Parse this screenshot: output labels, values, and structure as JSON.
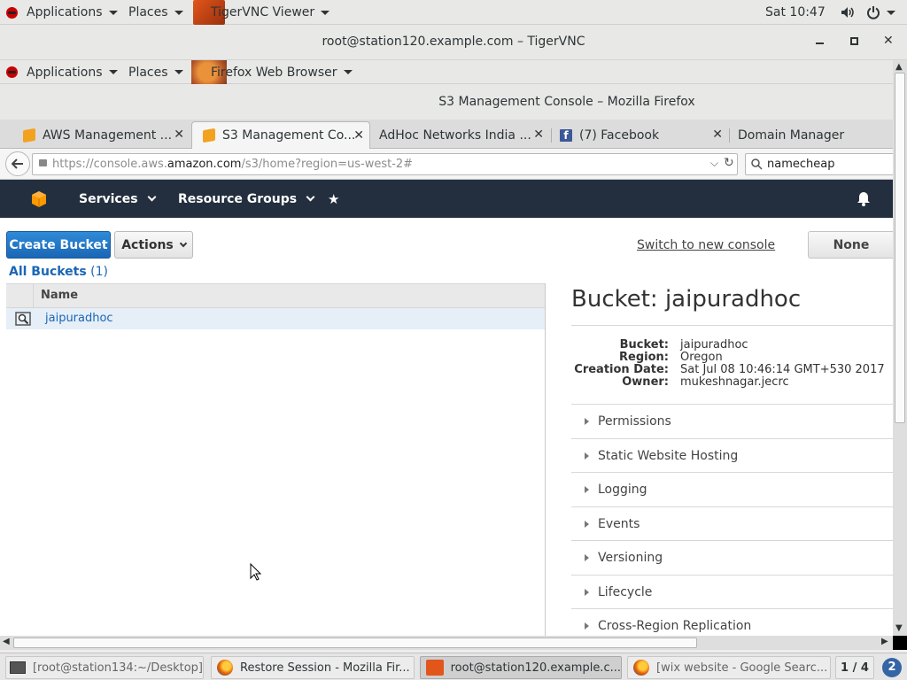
{
  "outer_bar": {
    "applications": "Applications",
    "places": "Places",
    "app_name": "TigerVNC Viewer",
    "clock": "Sat 10:47"
  },
  "vnc_window": {
    "title": "root@station120.example.com – TigerVNC"
  },
  "inner_bar": {
    "applications": "Applications",
    "places": "Places",
    "app_name": "Firefox Web Browser"
  },
  "firefox": {
    "title": "S3 Management Console – Mozilla Firefox",
    "tabs": [
      {
        "label": "AWS Management ..."
      },
      {
        "label": "S3 Management Co..."
      },
      {
        "label": "AdHoc Networks India ..."
      },
      {
        "label": "(7) Facebook"
      },
      {
        "label": "Domain Manager"
      }
    ],
    "url_prefix": "https://console.aws.",
    "url_domain": "amazon.com",
    "url_suffix": "/s3/home?region=us-west-2#",
    "search_value": "namecheap"
  },
  "aws": {
    "services": "Services",
    "resource_groups": "Resource Groups",
    "create_bucket": "Create Bucket",
    "actions": "Actions",
    "switch_console": "Switch to new console",
    "none_button": "None",
    "all_buckets": "All Buckets",
    "bucket_count": "(1)",
    "name_column": "Name",
    "buckets": [
      "jaipuradhoc"
    ],
    "detail_title": "Bucket: jaipuradhoc",
    "details": [
      {
        "label": "Bucket:",
        "value": "jaipuradhoc"
      },
      {
        "label": "Region:",
        "value": "Oregon"
      },
      {
        "label": "Creation Date:",
        "value": "Sat Jul 08 10:46:14 GMT+530 2017"
      },
      {
        "label": "Owner:",
        "value": "mukeshnagar.jecrc"
      }
    ],
    "sections": [
      "Permissions",
      "Static Website Hosting",
      "Logging",
      "Events",
      "Versioning",
      "Lifecycle",
      "Cross-Region Replication"
    ]
  },
  "taskbar": {
    "items": [
      {
        "label": "[root@station134:~/Desktop]"
      },
      {
        "label": "Restore Session - Mozilla Fir..."
      },
      {
        "label": "root@station120.example.c..."
      },
      {
        "label": "[wix website - Google Searc..."
      }
    ],
    "workspace": "1 / 4"
  }
}
